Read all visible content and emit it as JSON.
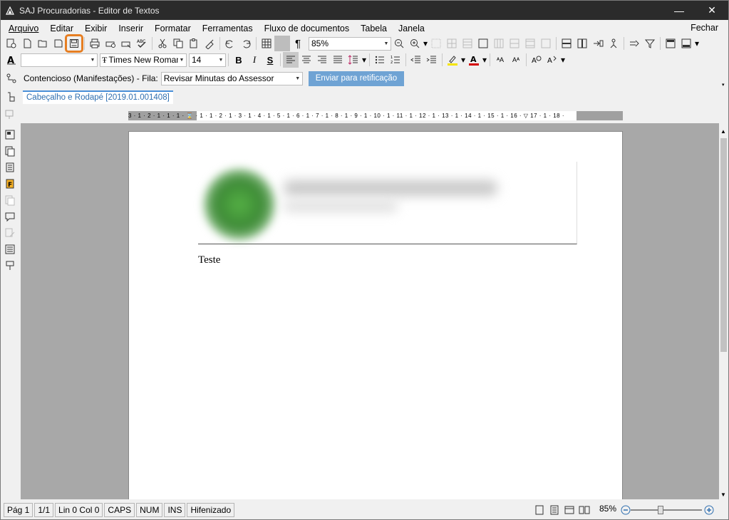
{
  "window": {
    "title": "SAJ Procuradorias - Editor de Textos",
    "minimize_glyph": "—",
    "close_glyph": "✕"
  },
  "menu": {
    "items": [
      "Arquivo",
      "Editar",
      "Exibir",
      "Inserir",
      "Formatar",
      "Ferramentas",
      "Fluxo de documentos",
      "Tabela",
      "Janela"
    ],
    "close_label": "Fechar"
  },
  "toolbar": {
    "zoom_value": "85%",
    "font_name": "Times New Roman",
    "font_size": "14",
    "style_value": "",
    "bold": "B",
    "italic": "I",
    "underline": "S",
    "highlight_color": "#f5e400",
    "font_color": "#d40000"
  },
  "flow": {
    "label": "Contencioso (Manifestações) - Fila:",
    "queue_value": "Revisar Minutas do Assessor",
    "send_button": "Enviar para retificação"
  },
  "tabs": [
    {
      "label": "Cabeçalho e Rodapé [2019.01.001408]"
    }
  ],
  "ruler": {
    "text": "3 · 1 · 2 · 1 · 1 · 1 · ⌛ · 1 · 1 · 2 · 1 · 3 · 1 · 4 · 1 · 5 · 1 · 6 · 1 · 7 · 1 · 8 · 1 · 9 · 1 · 10 · 1 · 11 · 1 · 12 · 1 · 13 · 1 · 14 · 1 · 15 · 1 · 16 · ▽ 17 · 1 · 18 ·"
  },
  "document": {
    "body_text": "Teste"
  },
  "status": {
    "page": "Pág 1",
    "pages": "1/1",
    "line_col": "Lin 0  Col 0",
    "caps": "CAPS",
    "num": "NUM",
    "ins": "INS",
    "hyphen": "Hifenizado",
    "zoom": "85%"
  },
  "colors": {
    "highlight_box": "#e67e22",
    "send_button_bg": "#6fa3d4",
    "tab_text": "#2f6fb0"
  }
}
